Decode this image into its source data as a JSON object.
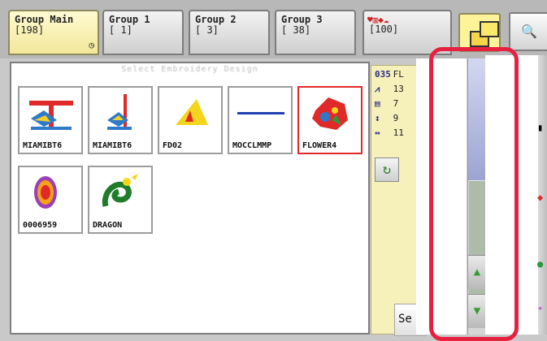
{
  "tabs": [
    {
      "name": "Group Main",
      "count": "[198]",
      "active": true,
      "has_sub_icon": true
    },
    {
      "name": "Group 1",
      "count": "[  1]",
      "active": false
    },
    {
      "name": "Group 2",
      "count": "[  3]",
      "active": false
    },
    {
      "name": "Group 3",
      "count": "[ 38]",
      "active": false
    },
    {
      "name": "",
      "count": "[100]",
      "active": false
    }
  ],
  "sub_icon_name": "clock-icon",
  "copy_button_icon": "stacked-pages-icon",
  "search_button_icon": "magnifier-icon",
  "panel": {
    "title_blurred": "Select Embroidery Design",
    "thumbnails": [
      {
        "label": "MIAMIBT6",
        "selected": false,
        "icon": "stitched-anchor-icon"
      },
      {
        "label": "MIAMIBT6",
        "selected": false,
        "icon": "stitched-tower-icon"
      },
      {
        "label": "FD02",
        "selected": false,
        "icon": "yellow-triangle-icon"
      },
      {
        "label": "MOCCLMMP",
        "selected": false,
        "icon": "blue-line-icon"
      },
      {
        "label": "FLOWER4",
        "selected": true,
        "icon": "flower-icon"
      },
      {
        "label": "0006959",
        "selected": false,
        "icon": "oval-badge-icon"
      },
      {
        "label": "DRAGON",
        "selected": false,
        "icon": "dragon-icon"
      }
    ]
  },
  "side_panel": {
    "design_id": "035",
    "design_name_partial": "FL",
    "stitch_count_partial": "13",
    "colors_partial": "7",
    "height_partial": "9",
    "width_partial": "11",
    "se_button": "Se"
  },
  "colors": {
    "tab_active_bg": "#f4e7a0",
    "selection_border": "#e02a2a",
    "red_outline": "#e82040",
    "info_panel_bg": "#f6f0ba"
  }
}
